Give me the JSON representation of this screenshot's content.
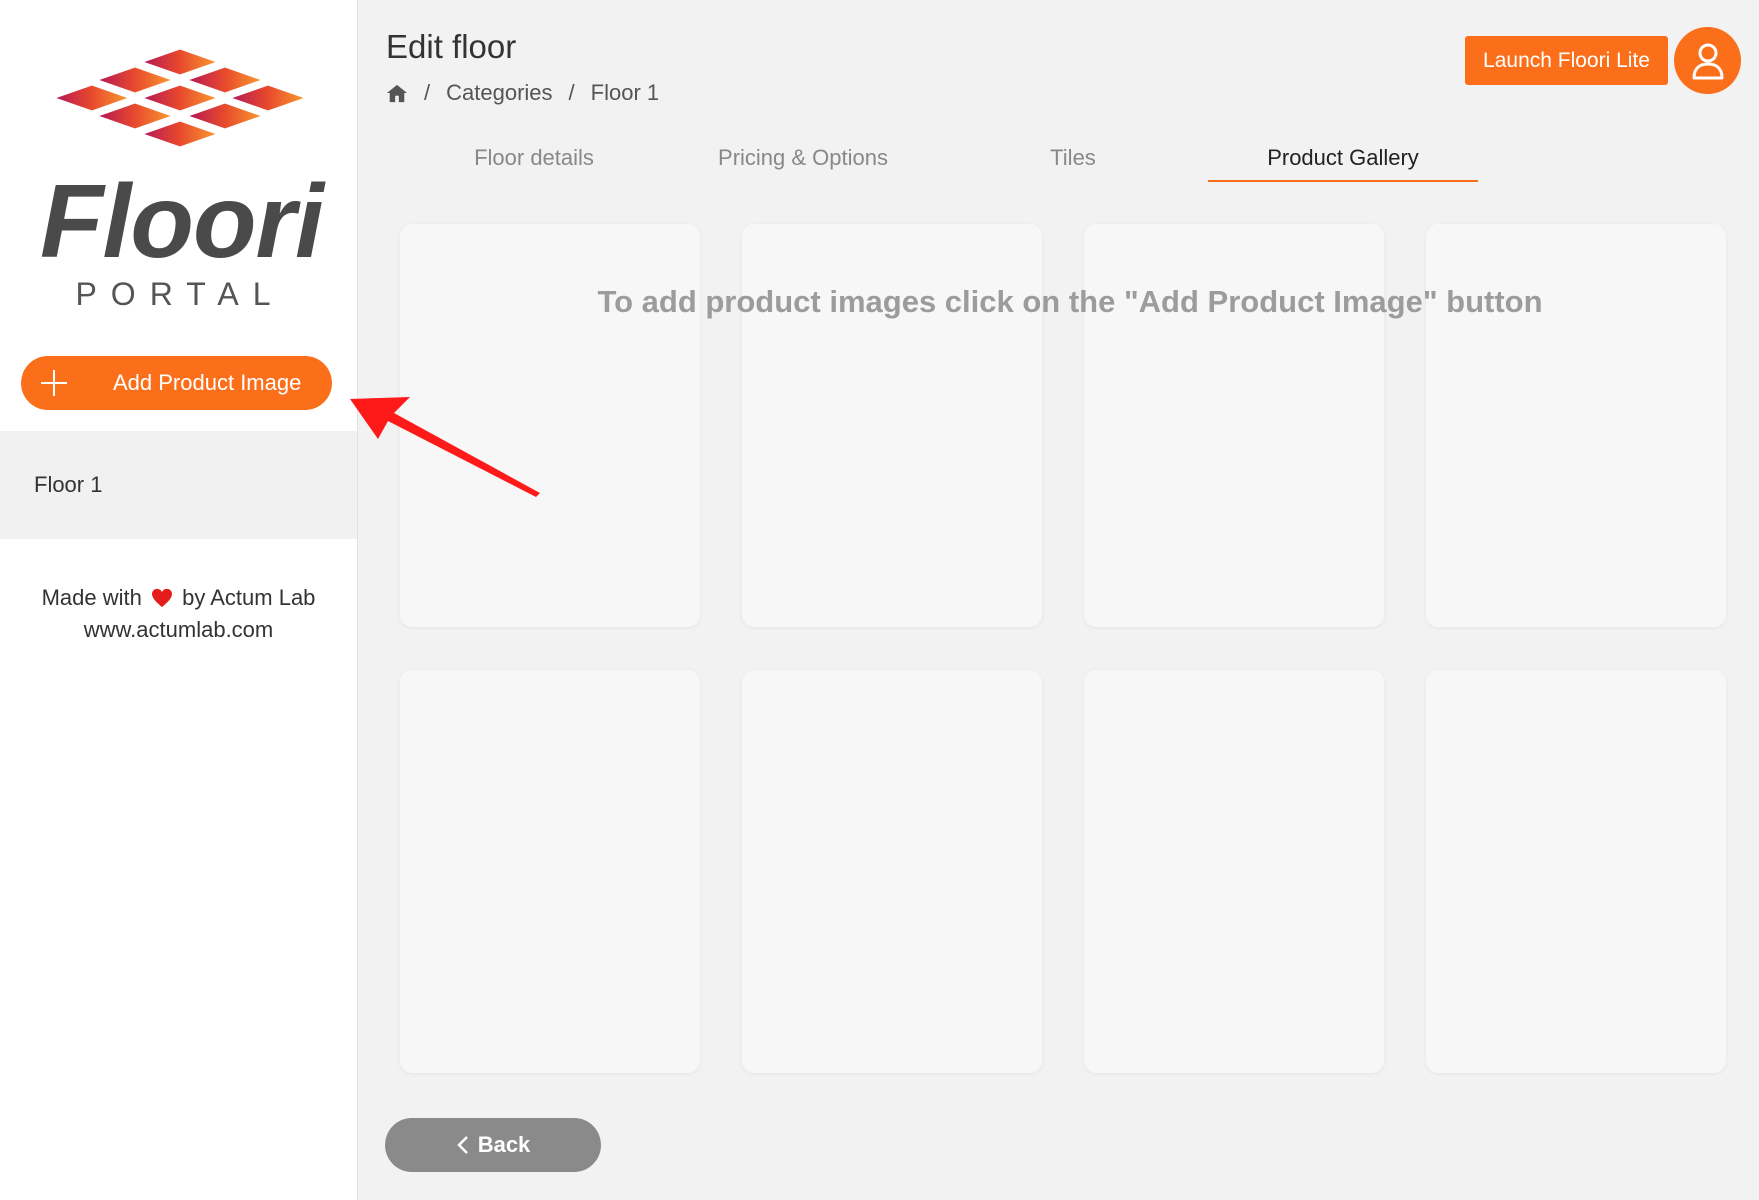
{
  "sidebar": {
    "logo": {
      "name": "Floori",
      "sub": "PORTAL"
    },
    "add_button_label": "Add Product Image",
    "items": [
      {
        "label": "Floor 1"
      }
    ],
    "footer": {
      "made_with": "Made with",
      "by": "by Actum Lab",
      "url": "www.actumlab.com"
    }
  },
  "header": {
    "title": "Edit floor",
    "breadcrumb": {
      "categories": "Categories",
      "current": "Floor 1"
    },
    "launch_button_label": "Launch Floori Lite"
  },
  "tabs": [
    {
      "label": "Floor details",
      "active": false
    },
    {
      "label": "Pricing & Options",
      "active": false
    },
    {
      "label": "Tiles",
      "active": false
    },
    {
      "label": "Product Gallery",
      "active": true
    }
  ],
  "gallery": {
    "empty_hint": "To add product images click on the \"Add Product Image\" button",
    "card_count": 8
  },
  "back_button_label": "Back",
  "colors": {
    "accent": "#fb6f1b",
    "back": "#8a8a8a",
    "heart": "#e51c1c",
    "annotation_arrow": "#ff1a1a"
  }
}
